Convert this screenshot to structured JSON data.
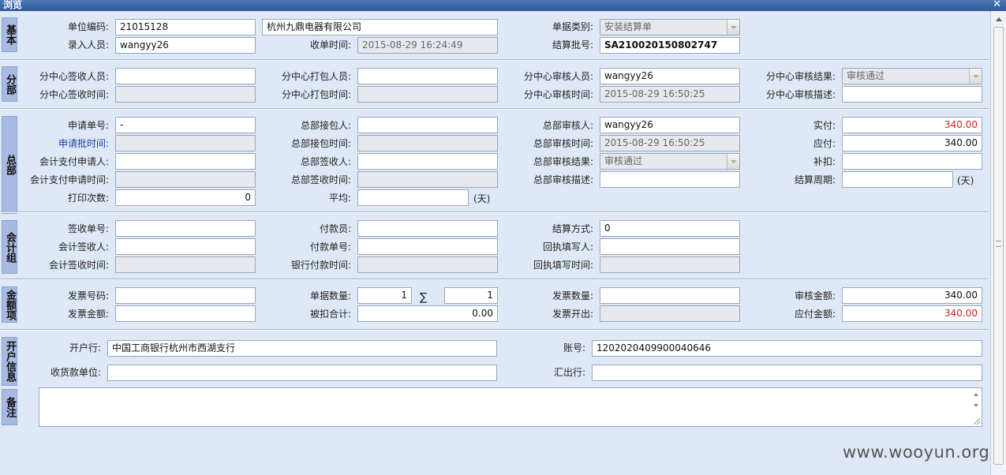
{
  "window": {
    "title": "浏览",
    "close_glyph": "✕"
  },
  "sections": {
    "basic": "基本",
    "branch": "分部",
    "hq": "总部",
    "accounting": "会计组",
    "amounts": "金额项",
    "bank": "开户信息",
    "remarks": "备注"
  },
  "basic": {
    "unit_code_label": "单位编码:",
    "unit_code": "21015128",
    "unit_name": "杭州九鼎电器有限公司",
    "doc_type_label": "单据类别:",
    "doc_type": "安装结算单",
    "entry_person_label": "录入人员:",
    "entry_person": "wangyy26",
    "receive_time_label": "收单时间:",
    "receive_time": "2015-08-29 16:24:49",
    "batch_no_label": "结算批号:",
    "batch_no": "SA210020150802747"
  },
  "branch": {
    "sign_person_label": "分中心签收人员:",
    "sign_person": "",
    "pack_person_label": "分中心打包人员:",
    "pack_person": "",
    "review_person_label": "分中心审核人员:",
    "review_person": "wangyy26",
    "review_result_label": "分中心审核结果:",
    "review_result": "审核通过",
    "sign_time_label": "分中心签收时间:",
    "sign_time": "",
    "pack_time_label": "分中心打包时间:",
    "pack_time": "",
    "review_time_label": "分中心审核时间:",
    "review_time": "2015-08-29 16:50:25",
    "review_desc_label": "分中心审核描述:",
    "review_desc": ""
  },
  "hq": {
    "apply_no_label": "申请单号:",
    "apply_no": "-",
    "pack_recv_label": "总部接包人:",
    "pack_recv": "",
    "reviewer_label": "总部审核人:",
    "reviewer": "wangyy26",
    "actual_pay_label": "实付:",
    "actual_pay": "340.00",
    "apply_batch_time_label": "申请批时间:",
    "apply_batch_time": "",
    "pack_recv_time_label": "总部接包时间:",
    "pack_recv_time": "",
    "review_time_label": "总部审核时间:",
    "review_time": "2015-08-29 16:50:25",
    "payable_label": "应付:",
    "payable": "340.00",
    "acct_applicant_label": "会计支付申请人:",
    "acct_applicant": "",
    "sign_person_label": "总部签收人:",
    "sign_person": "",
    "review_result_label": "总部审核结果:",
    "review_result": "审核通过",
    "deduct_label": "补扣:",
    "deduct": "",
    "acct_apply_time_label": "会计支付申请时间:",
    "acct_apply_time": "",
    "sign_time_label": "总部签收时间:",
    "sign_time": "",
    "review_desc_label": "总部审核描述:",
    "review_desc": "",
    "settle_period_label": "结算周期:",
    "settle_period": "",
    "print_count_label": "打印次数:",
    "print_count": "0",
    "average_label": "平均:",
    "average": "",
    "day_unit": "(天)"
  },
  "accounting": {
    "sign_no_label": "签收单号:",
    "sign_no": "",
    "payer_label": "付款员:",
    "payer": "",
    "settle_method_label": "结算方式:",
    "settle_method": "0",
    "acct_signer_label": "会计签收人:",
    "acct_signer": "",
    "pay_no_label": "付款单号:",
    "pay_no": "",
    "receipt_writer_label": "回执填写人:",
    "receipt_writer": "",
    "acct_sign_time_label": "会计签收时间:",
    "acct_sign_time": "",
    "bank_pay_time_label": "银行付款时间:",
    "bank_pay_time": "",
    "receipt_time_label": "回执填写时间:",
    "receipt_time": ""
  },
  "amounts": {
    "invoice_no_label": "发票号码:",
    "invoice_no": "",
    "doc_count_label": "单据数量:",
    "doc_count": "1",
    "sigma": "∑",
    "doc_count_sum": "1",
    "invoice_count_label": "发票数量:",
    "invoice_count": "",
    "review_amount_label": "审核金额:",
    "review_amount": "340.00",
    "invoice_amount_label": "发票金额:",
    "invoice_amount": "",
    "deducted_total_label": "被扣合计:",
    "deducted_total": "0.00",
    "invoice_issued_label": "发票开出:",
    "invoice_issued": "",
    "payable_amount_label": "应付金额:",
    "payable_amount": "340.00"
  },
  "bank": {
    "bank_label": "开户行:",
    "bank": "中国工商银行杭州市西湖支行",
    "account_label": "账号:",
    "account": "1202020409900040646",
    "payee_label": "收货款单位:",
    "payee": "",
    "remit_bank_label": "汇出行:",
    "remit_bank": ""
  },
  "remarks": {
    "text": ""
  },
  "watermark": "www.wooyun.org",
  "colors": {
    "title_bar": "#3a67a8",
    "section_label": "#a8b9e2",
    "background": "#dfe8f6",
    "red_value": "#d21f1f"
  }
}
